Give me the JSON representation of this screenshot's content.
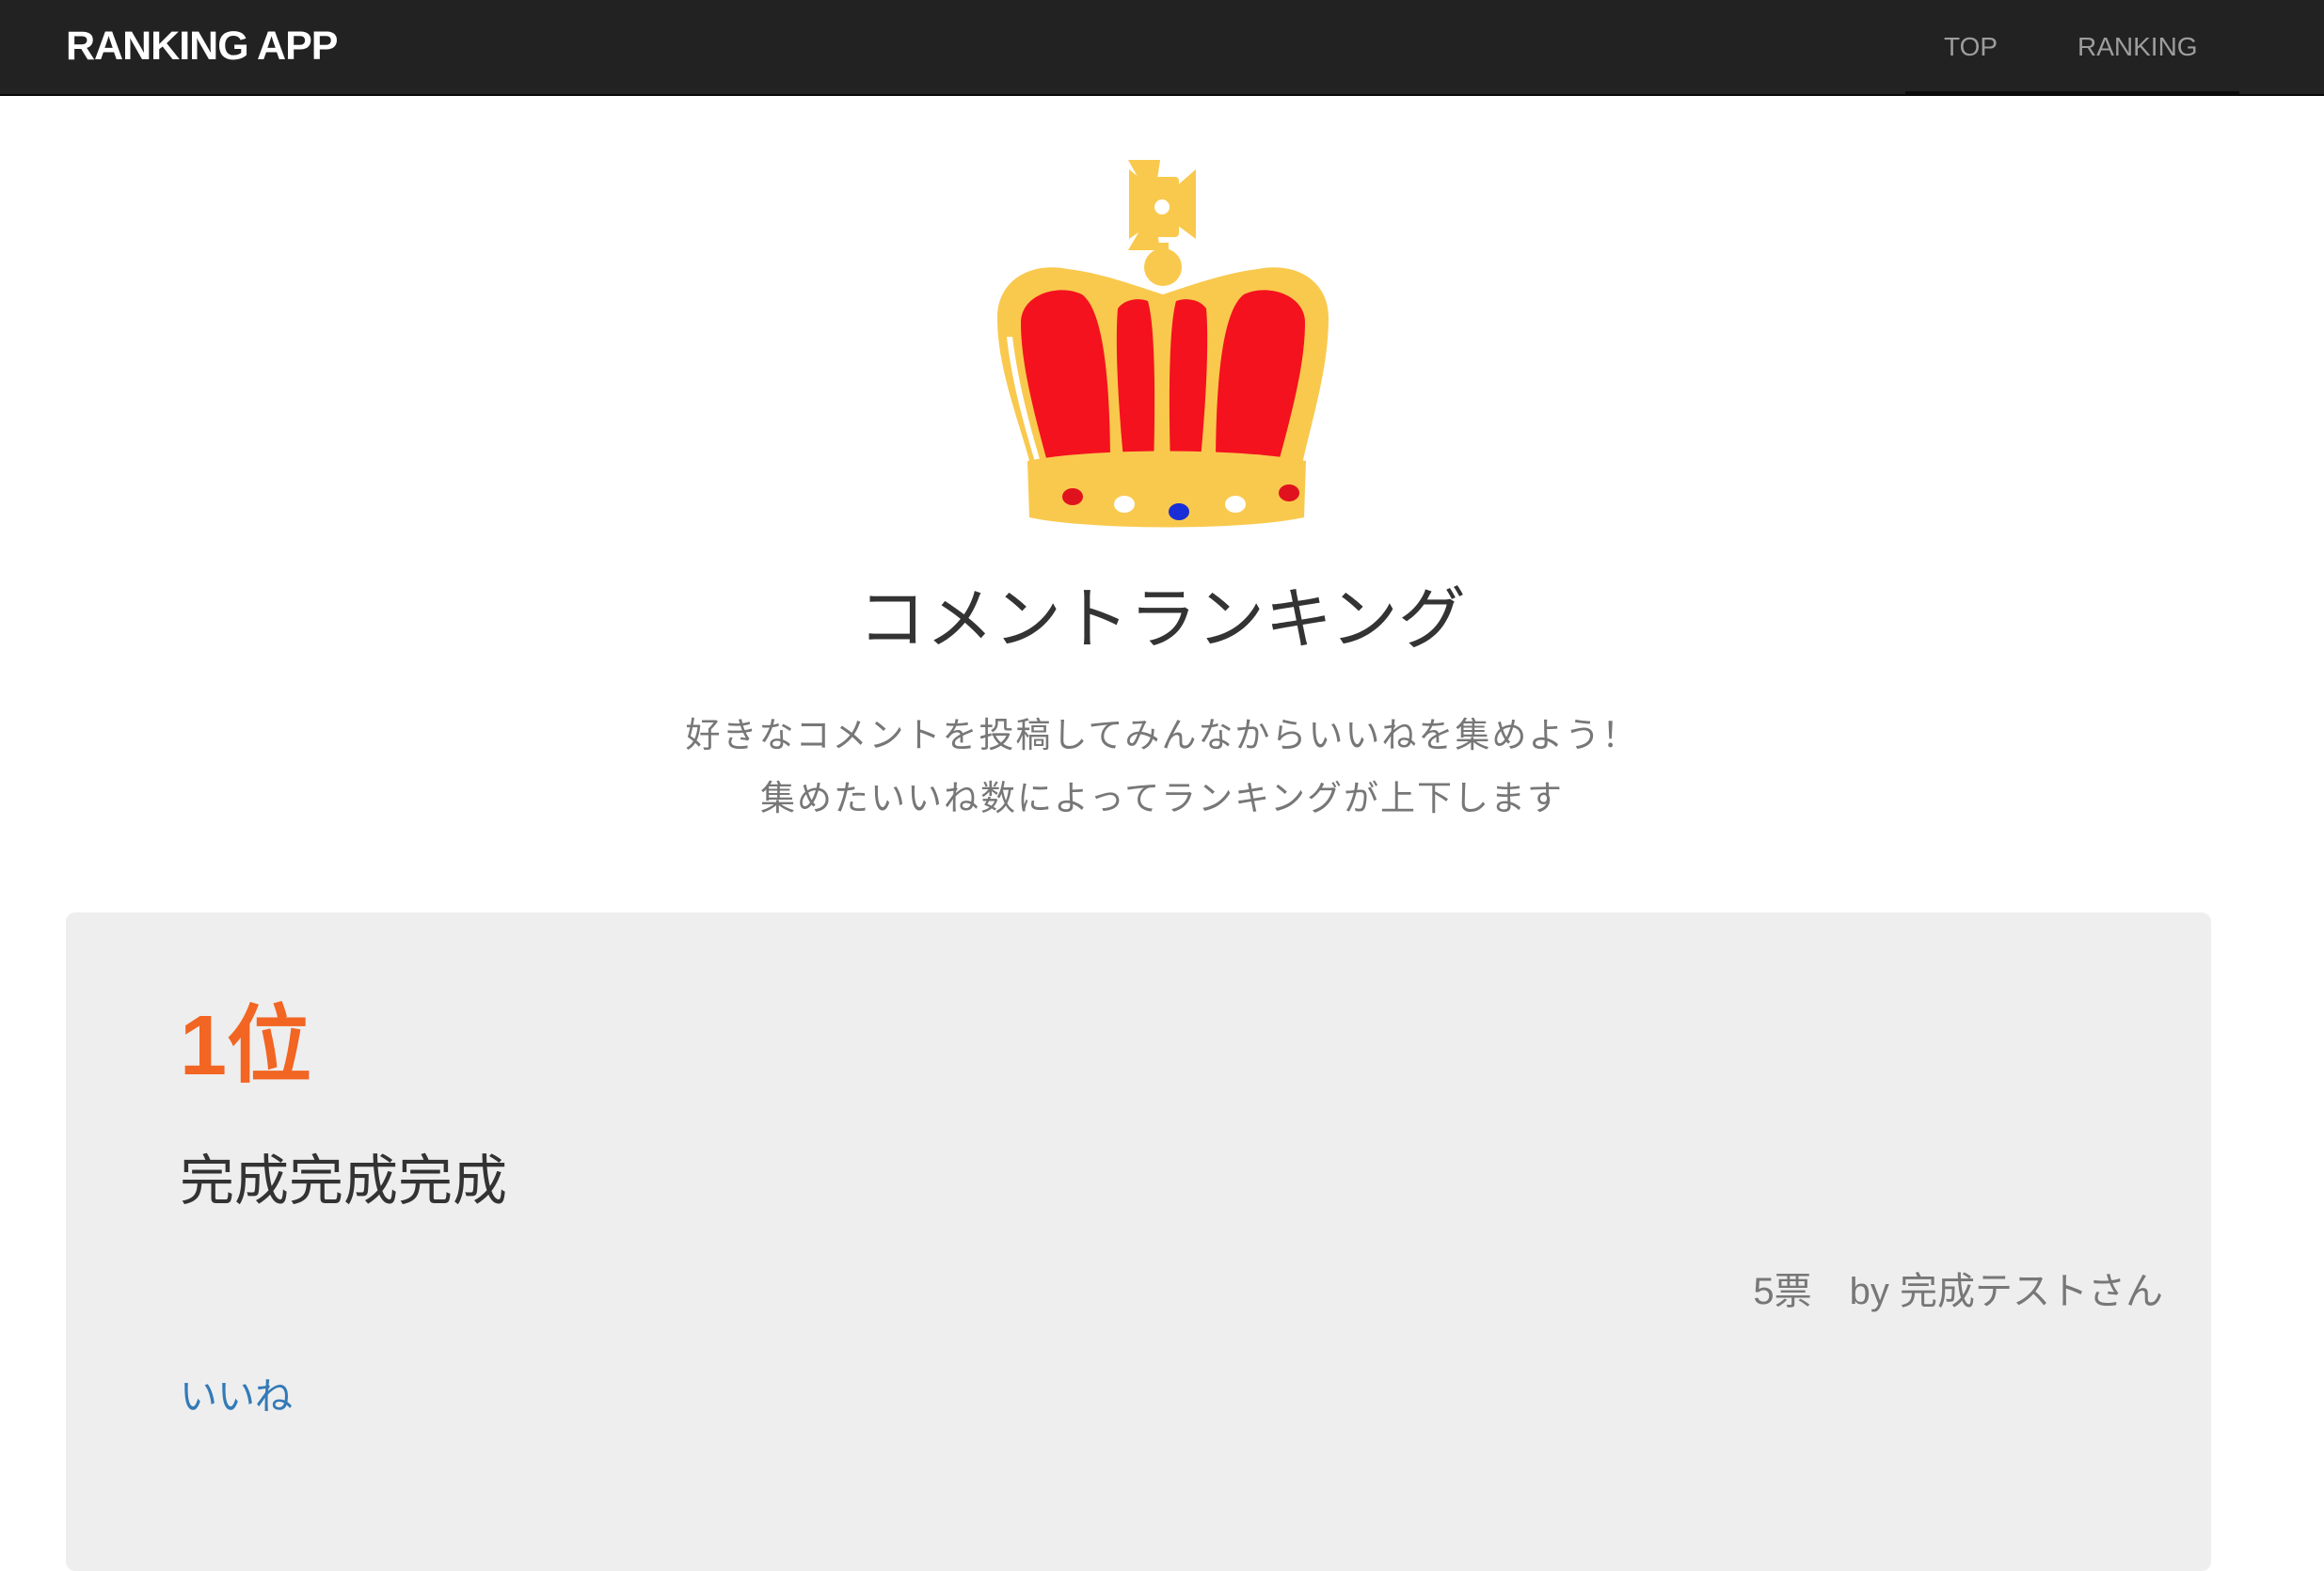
{
  "navbar": {
    "brand": "RANKING APP",
    "links": [
      "TOP",
      "RANKING"
    ]
  },
  "hero": {
    "icon": "crown-icon",
    "title": "コメントランキング",
    "subtitle_lines": [
      "好きなコメントを投稿してみんなからいいねを集めよう！",
      "集めたいいね数によってランキングが上下します"
    ]
  },
  "ranking": {
    "items": [
      {
        "rank": "1位",
        "comment": "完成完成完成",
        "votes": "5票",
        "author": "by 完成テストさん",
        "like_label": "いいね"
      }
    ]
  },
  "colors": {
    "navbar_bg": "#222222",
    "rank_accent": "#f26522",
    "link": "#337ab7",
    "card_bg": "#eeeeee",
    "crown_gold": "#f9c94e",
    "crown_red": "#f4121e"
  }
}
